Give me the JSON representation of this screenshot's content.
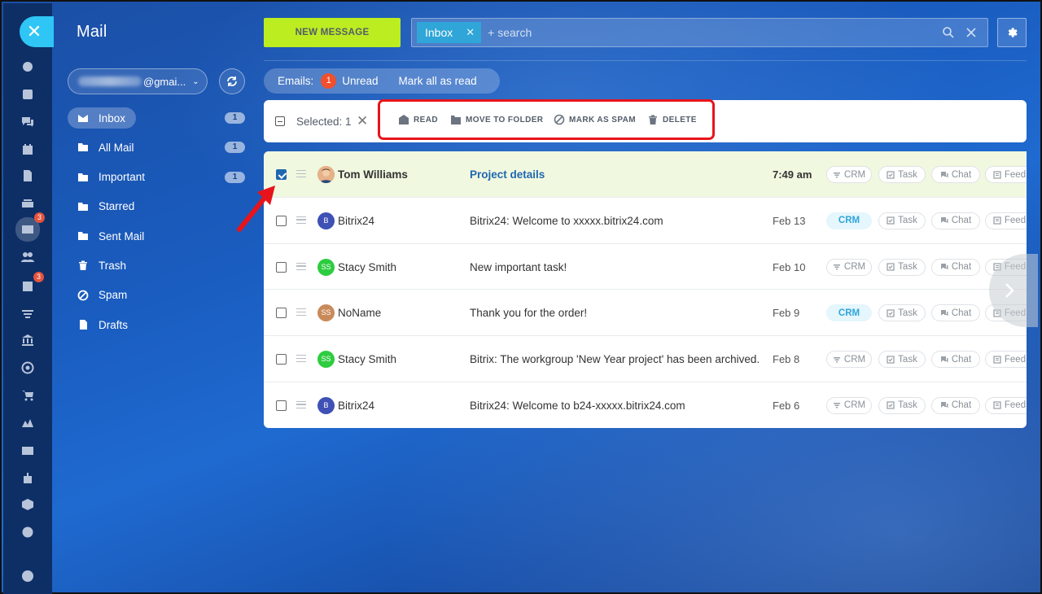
{
  "app": {
    "title": "Mail"
  },
  "rail": {
    "items": [
      {
        "icon": "dashboard-icon",
        "top": 0
      },
      {
        "icon": "feed-icon"
      },
      {
        "icon": "chat-icon"
      },
      {
        "icon": "calendar-icon"
      },
      {
        "icon": "document-icon"
      },
      {
        "icon": "drive-icon"
      },
      {
        "icon": "mail-icon",
        "badge": "3"
      },
      {
        "icon": "people-icon"
      },
      {
        "icon": "tasks-icon",
        "badge": "3"
      },
      {
        "icon": "filter-icon"
      },
      {
        "icon": "bank-icon"
      },
      {
        "icon": "target-icon"
      },
      {
        "icon": "cart-icon"
      },
      {
        "icon": "signature-icon"
      },
      {
        "icon": "contact-card-icon"
      },
      {
        "icon": "robot-icon"
      },
      {
        "icon": "box-icon"
      },
      {
        "icon": "more-icon"
      },
      {
        "icon": "help-icon"
      }
    ]
  },
  "account": {
    "email_suffix": "@gmai..."
  },
  "folders": [
    {
      "label": "Inbox",
      "count": "1",
      "icon": "inbox-icon"
    },
    {
      "label": "All Mail",
      "count": "1",
      "icon": "folder-icon"
    },
    {
      "label": "Important",
      "count": "1",
      "icon": "folder-icon"
    },
    {
      "label": "Starred",
      "count": "",
      "icon": "folder-icon"
    },
    {
      "label": "Sent Mail",
      "count": "",
      "icon": "sent-icon"
    },
    {
      "label": "Trash",
      "count": "",
      "icon": "trash-icon"
    },
    {
      "label": "Spam",
      "count": "",
      "icon": "spam-icon"
    },
    {
      "label": "Drafts",
      "count": "",
      "icon": "drafts-icon"
    }
  ],
  "toolbar": {
    "new_message": "NEW MESSAGE",
    "filter_chip": "Inbox",
    "search_placeholder": "+ search"
  },
  "emails_bar": {
    "label": "Emails:",
    "unread_count": "1",
    "unread_label": "Unread",
    "mark_all": "Mark all as read"
  },
  "selection": {
    "text": "Selected: 1",
    "actions": {
      "read": "READ",
      "move": "MOVE TO FOLDER",
      "spam": "MARK AS SPAM",
      "delete": "DELETE"
    }
  },
  "pill_labels": {
    "crm": "CRM",
    "task": "Task",
    "chat": "Chat",
    "feed": "Feed"
  },
  "messages": [
    {
      "sender": "Tom Williams",
      "initials": "",
      "avatar_color": "#c98a5a",
      "subject": "Project details",
      "date": "7:49 am",
      "checked": true,
      "crm_active": false
    },
    {
      "sender": "Bitrix24",
      "initials": "B",
      "avatar_color": "#3f51b5",
      "subject": "Bitrix24: Welcome to xxxxx.bitrix24.com",
      "date": "Feb 13",
      "checked": false,
      "crm_active": true
    },
    {
      "sender": "Stacy Smith",
      "initials": "SS",
      "avatar_color": "#2ecc40",
      "subject": "New important task!",
      "date": "Feb 10",
      "checked": false,
      "crm_active": false
    },
    {
      "sender": "NoName",
      "initials": "SS",
      "avatar_color": "#c98a5a",
      "subject": "Thank you for the order!",
      "date": "Feb 9",
      "checked": false,
      "crm_active": true
    },
    {
      "sender": "Stacy Smith",
      "initials": "SS",
      "avatar_color": "#2ecc40",
      "subject": "Bitrix: The workgroup 'New Year project' has been archived.",
      "date": "Feb 8",
      "checked": false,
      "crm_active": false
    },
    {
      "sender": "Bitrix24",
      "initials": "B",
      "avatar_color": "#3f51b5",
      "subject": "Bitrix24: Welcome to b24-xxxxx.bitrix24.com",
      "date": "Feb 6",
      "checked": false,
      "crm_active": false
    }
  ],
  "colors": {
    "accent_green": "#bbed21",
    "accent_blue": "#2fc6f6",
    "highlight_red": "#e8141b",
    "link_blue": "#2067b0"
  }
}
